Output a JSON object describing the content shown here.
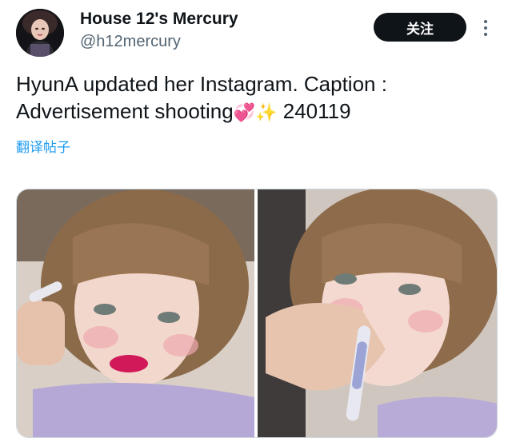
{
  "author": {
    "display_name": "House 12's Mercury",
    "handle": "@h12mercury"
  },
  "follow_label": "关注",
  "more_icon": "more-vertical-icon",
  "tweet": {
    "text": "HyunA updated her Instagram. Caption : Advertisement shooting",
    "emojis": "💞✨",
    "date_code": "240119"
  },
  "translate_label": "翻译帖子",
  "colors": {
    "accent": "#1d9bf0",
    "button_bg": "#0f1419",
    "secondary_text": "#536471"
  }
}
